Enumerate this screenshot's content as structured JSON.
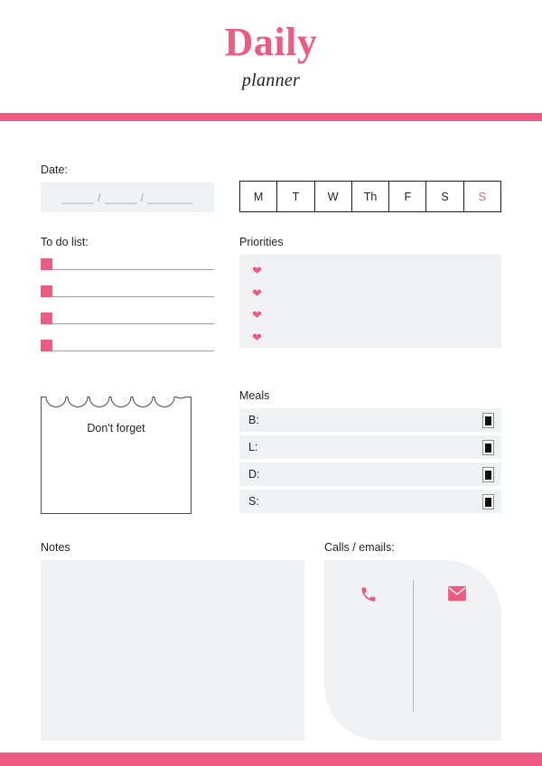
{
  "header": {
    "title_main": "Daily",
    "title_sub": "planner"
  },
  "date_section": {
    "label": "Date:",
    "placeholder": "_____ / _____ / _______",
    "value": ""
  },
  "days": [
    {
      "label": "M",
      "accent": false
    },
    {
      "label": "T",
      "accent": false
    },
    {
      "label": "W",
      "accent": false
    },
    {
      "label": "Th",
      "accent": false
    },
    {
      "label": "F",
      "accent": false
    },
    {
      "label": "S",
      "accent": false
    },
    {
      "label": "S",
      "accent": true
    }
  ],
  "todo": {
    "label": "To do list:",
    "items": [
      {
        "checked": false,
        "text": ""
      },
      {
        "checked": false,
        "text": ""
      },
      {
        "checked": false,
        "text": ""
      },
      {
        "checked": false,
        "text": ""
      }
    ]
  },
  "priorities": {
    "label": "Priorities",
    "items": [
      {
        "bullet": "heart-icon",
        "text": ""
      },
      {
        "bullet": "heart-icon",
        "text": ""
      },
      {
        "bullet": "heart-icon",
        "text": ""
      },
      {
        "bullet": "heart-icon",
        "text": ""
      }
    ]
  },
  "dont_forget": {
    "label": "Don't forget",
    "scallop_count": 7,
    "text": ""
  },
  "meals": {
    "label": "Meals",
    "rows": [
      {
        "label": "B:",
        "value": "",
        "icon": "glass-icon"
      },
      {
        "label": "L:",
        "value": "",
        "icon": "glass-icon"
      },
      {
        "label": "D:",
        "value": "",
        "icon": "glass-icon"
      },
      {
        "label": "S:",
        "value": "",
        "icon": "glass-icon"
      }
    ]
  },
  "notes": {
    "label": "Notes",
    "value": ""
  },
  "calls": {
    "label": "Calls / emails:",
    "columns": [
      {
        "icon": "phone-icon",
        "value": ""
      },
      {
        "icon": "envelope-icon",
        "value": ""
      }
    ]
  },
  "colors": {
    "accent_pink": "#ee5a80",
    "panel_gray": "#f0f1f3",
    "line_gray": "#9a9da3",
    "text_dark": "#231f20"
  }
}
